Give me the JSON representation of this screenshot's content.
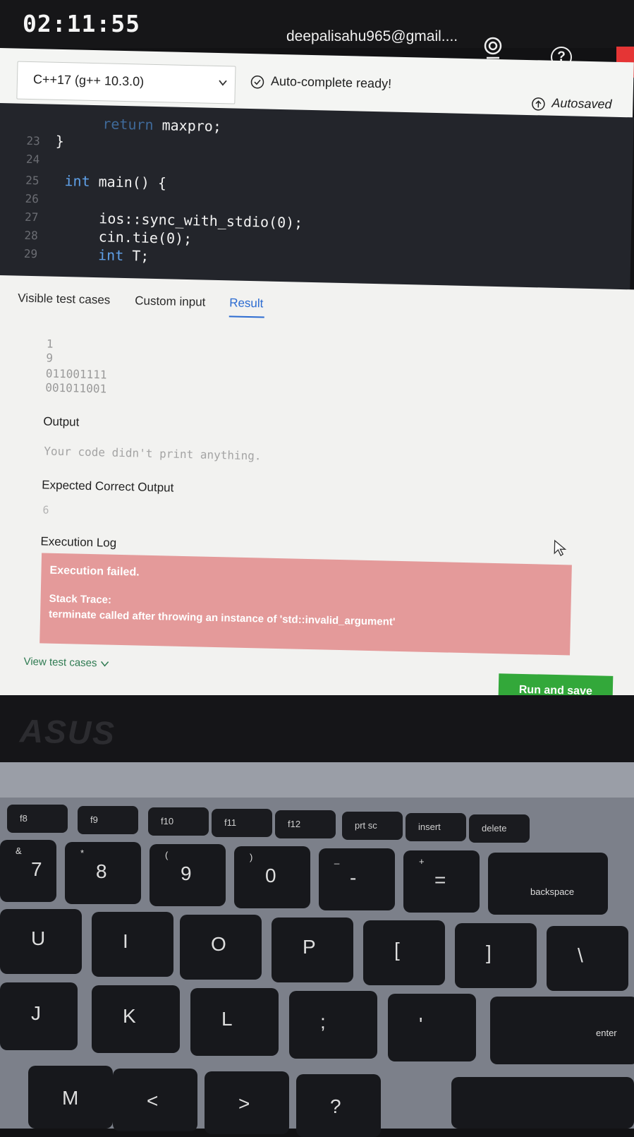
{
  "header": {
    "timer": "02:11:55",
    "user_email": "deepalisahu965@gmail....",
    "icons": {
      "webcam": "webcam-icon",
      "help": "help-icon",
      "help_glyph": "?"
    }
  },
  "toolbar": {
    "language": "C++17 (g++ 10.3.0)",
    "autocomplete_status": "Auto-complete ready!",
    "autosave_status": "Autosaved"
  },
  "editor": {
    "lines": [
      {
        "num": "",
        "tokens": [
          {
            "t": "return",
            "kw": true
          },
          {
            "t": " maxpro;",
            "kw": false
          }
        ]
      },
      {
        "num": "23",
        "tokens": [
          {
            "t": "}",
            "kw": false
          }
        ]
      },
      {
        "num": "24",
        "tokens": []
      },
      {
        "num": "25",
        "tokens": [
          {
            "t": "int",
            "kw": true
          },
          {
            "t": " main() {",
            "kw": false
          }
        ]
      },
      {
        "num": "26",
        "tokens": []
      },
      {
        "num": "27",
        "tokens": [
          {
            "t": "ios::sync_with_stdio(0);",
            "kw": false
          }
        ]
      },
      {
        "num": "28",
        "tokens": [
          {
            "t": "cin.tie(0);",
            "kw": false
          }
        ]
      },
      {
        "num": "29",
        "tokens": [
          {
            "t": "int",
            "kw": true
          },
          {
            "t": " T;",
            "kw": false
          }
        ]
      }
    ]
  },
  "results": {
    "tabs": [
      "Visible test cases",
      "Custom input",
      "Result"
    ],
    "active_tab": "Result",
    "input_lines": [
      "1",
      "9",
      "011001111",
      "001011001"
    ],
    "output_label": "Output",
    "output_text": "Your code didn't print anything.",
    "expected_label": "Expected Correct Output",
    "expected_value": "6",
    "execution_log_label": "Execution Log",
    "execution_failed": "Execution failed.",
    "stack_trace_title": "Stack Trace:",
    "stack_trace": "terminate called after throwing an instance of 'std::invalid_argument'",
    "view_test_cases": "View test cases",
    "run_and_save": "Run and save"
  },
  "laptop": {
    "brand": "ASUS",
    "fkeys": [
      "f8",
      "f9",
      "f10",
      "f11",
      "f12",
      "prt sc",
      "insert",
      "delete"
    ],
    "row1": [
      {
        "main": "7",
        "shift": "&"
      },
      {
        "main": "8",
        "shift": "*"
      },
      {
        "main": "9",
        "shift": "("
      },
      {
        "main": "0",
        "shift": ")"
      },
      {
        "main": "-",
        "shift": "_"
      },
      {
        "main": "=",
        "shift": "+"
      },
      {
        "main": "backspace",
        "shift": ""
      }
    ],
    "row2": [
      "U",
      "I",
      "O",
      "P",
      "[",
      "]",
      "\\"
    ],
    "row3": [
      "J",
      "K",
      "L",
      ";",
      "'",
      "enter"
    ],
    "row4": [
      "M",
      "<",
      ">",
      "?"
    ]
  }
}
